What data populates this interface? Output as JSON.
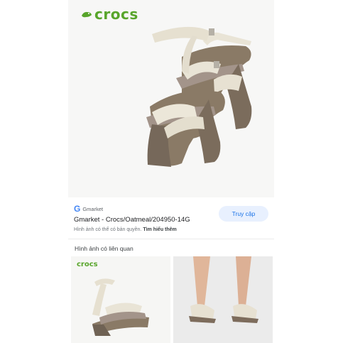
{
  "header": {
    "close_icon": "close-icon",
    "lens_icon": "lens-icon",
    "share_icon": "share-icon"
  },
  "product_image": {
    "brand_logo_text": "crocs",
    "brand_color": "#58a52b"
  },
  "result": {
    "source_icon": "G",
    "source_name": "Gmarket",
    "title": "Gmarket - Crocs/Oatmeal/204950-14G",
    "copyright_text": "Hình ảnh có thể có bản quyền.",
    "learn_more": "Tìm hiểu thêm",
    "visit_button": "Truy cập"
  },
  "related": {
    "heading": "Hình ảnh có liên quan",
    "thumbnails": [
      {
        "logo_text": "crocs"
      },
      {
        "logo_text": ""
      }
    ]
  }
}
